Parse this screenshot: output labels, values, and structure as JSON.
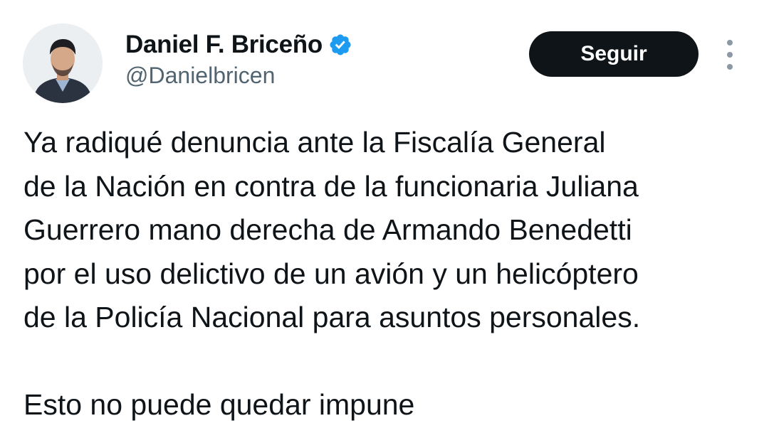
{
  "author": {
    "display_name": "Daniel F. Briceño",
    "handle": "@Danielbricen",
    "verified_icon": "verified-badge-icon"
  },
  "actions": {
    "follow_label": "Seguir",
    "more_icon": "more-vertical-icon"
  },
  "tweet": {
    "lines": [
      "Ya radiqué denuncia ante la Fiscalía General",
      "de la Nación en contra de la funcionaria Juliana",
      "Guerrero mano derecha de Armando Benedetti",
      "por el uso delictivo de un avión y un helicóptero",
      "de la Policía Nacional para asuntos personales."
    ],
    "closing_line": "Esto no puede quedar impune"
  },
  "colors": {
    "text": "#0f1419",
    "secondary_text": "#536471",
    "button_bg": "#0f1419",
    "verified_blue": "#1d9bf0"
  }
}
